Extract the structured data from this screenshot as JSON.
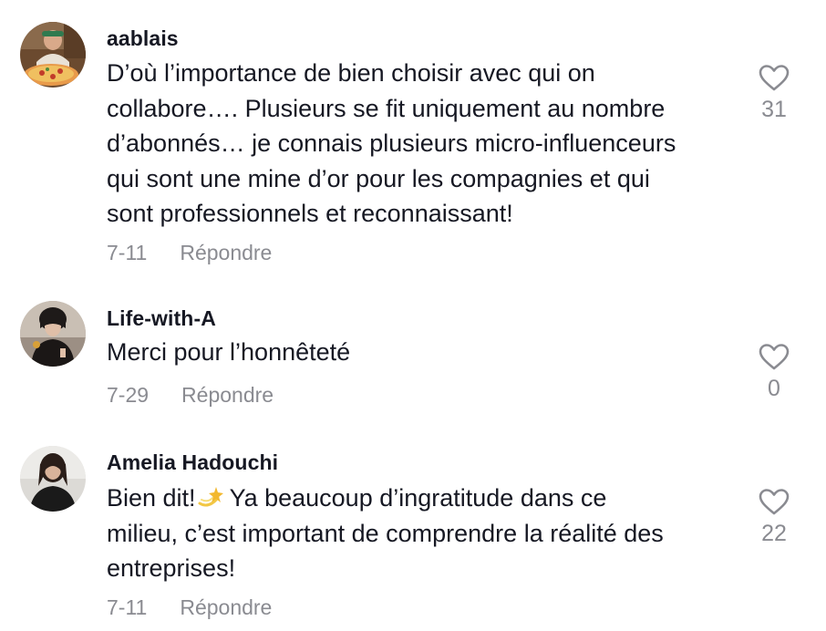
{
  "comments": [
    {
      "username": "aablais",
      "lines": [
        "D’où l’importance de bien choisir avec qui on",
        "collabore…. Plusieurs se fit uniquement au nombre",
        "d’abonnés… je connais plusieurs micro-influenceurs",
        "qui sont une mine d’or pour les compagnies et qui",
        "sont professionnels et reconnaissant!"
      ],
      "date": "7-11",
      "reply_label": "Répondre",
      "likes": "31",
      "avatar_icon": "avatar-pizza-photo"
    },
    {
      "username": "Life-with-A",
      "lines": [
        "Merci pour l’honnêteté"
      ],
      "date": "7-29",
      "reply_label": "Répondre",
      "likes": "0",
      "avatar_icon": "avatar-portrait-photo"
    },
    {
      "username": "Amelia Hadouchi",
      "lines_first_before_emoji": "Bien dit!",
      "lines_first_after_emoji": " Ya beaucoup d’ingratitude dans ce",
      "lines": [
        "milieu, c’est important de comprendre la réalité des",
        "entreprises!"
      ],
      "date": "7-11",
      "reply_label": "Répondre",
      "likes": "22",
      "avatar_icon": "avatar-portrait-photo",
      "emoji": "dizzy-emoji"
    }
  ],
  "colors": {
    "text": "#161823",
    "secondary": "#8a8b91"
  }
}
